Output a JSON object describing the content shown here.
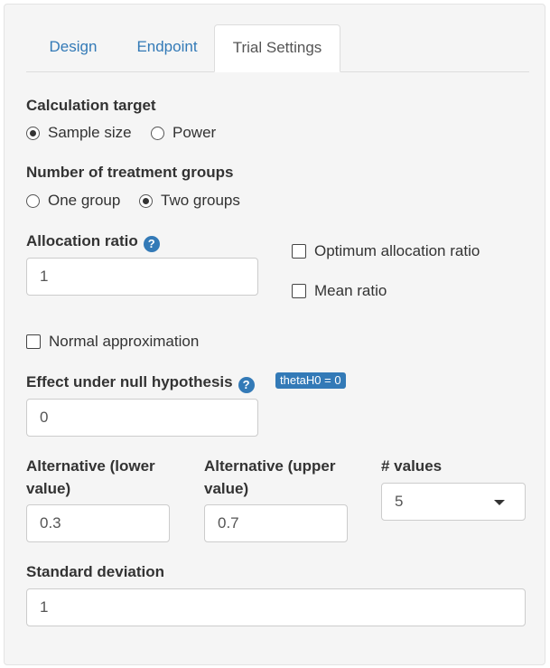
{
  "tabs": [
    {
      "label": "Design",
      "active": false
    },
    {
      "label": "Endpoint",
      "active": false
    },
    {
      "label": "Trial Settings",
      "active": true
    }
  ],
  "calculation_target": {
    "label": "Calculation target",
    "options": [
      {
        "label": "Sample size",
        "checked": true
      },
      {
        "label": "Power",
        "checked": false
      }
    ]
  },
  "treatment_groups": {
    "label": "Number of treatment groups",
    "options": [
      {
        "label": "One group",
        "checked": false
      },
      {
        "label": "Two groups",
        "checked": true
      }
    ]
  },
  "allocation_ratio": {
    "label": "Allocation ratio",
    "help_glyph": "?",
    "value": "1"
  },
  "optimum_allocation": {
    "label": "Optimum allocation ratio",
    "checked": false
  },
  "mean_ratio": {
    "label": "Mean ratio",
    "checked": false
  },
  "normal_approximation": {
    "label": "Normal approximation",
    "checked": false
  },
  "null_effect": {
    "label": "Effect under null hypothesis",
    "help_glyph": "?",
    "badge": "thetaH0 = 0",
    "value": "0"
  },
  "alt_lower": {
    "label_line1": "Alternative (lower",
    "label_line2": "value)",
    "value": "0.3"
  },
  "alt_upper": {
    "label_line1": "Alternative (upper",
    "label_line2": "value)",
    "value": "0.7"
  },
  "num_values": {
    "label": "# values",
    "selected": "5"
  },
  "std_dev": {
    "label": "Standard deviation",
    "value": "1"
  },
  "colors": {
    "link": "#337ab7",
    "panel_bg": "#f5f5f5",
    "badge_bg": "#337ab7"
  }
}
